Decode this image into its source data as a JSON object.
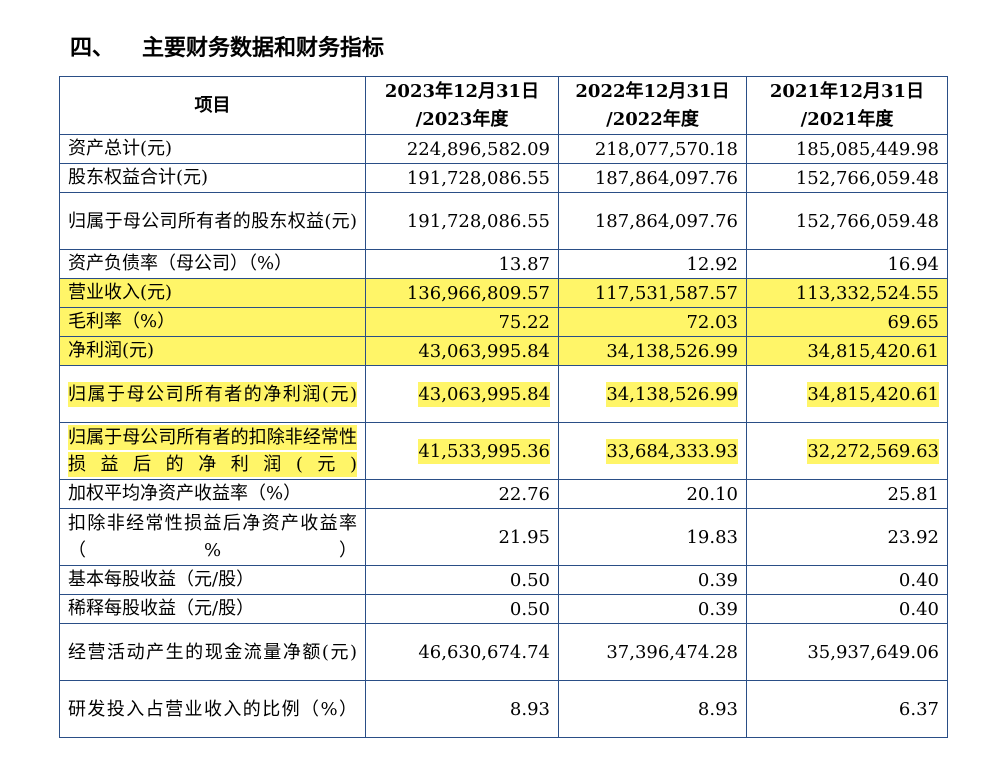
{
  "section": {
    "number": "四、",
    "title": "主要财务数据和财务指标"
  },
  "table": {
    "header": {
      "item": "项目",
      "cols": [
        {
          "line1": "2023年12月31日",
          "line2": "/2023年度"
        },
        {
          "line1": "2022年12月31日",
          "line2": "/2022年度"
        },
        {
          "line1": "2021年12月31日",
          "line2": "/2021年度"
        }
      ]
    },
    "rows": [
      {
        "label": "资产总计(元)",
        "values": [
          "224,896,582.09",
          "218,077,570.18",
          "185,085,449.98"
        ],
        "highlight": "none"
      },
      {
        "label": "股东权益合计(元)",
        "values": [
          "191,728,086.55",
          "187,864,097.76",
          "152,766,059.48"
        ],
        "highlight": "none"
      },
      {
        "label": "归属于母公司所有者的股东权益(元)",
        "values": [
          "191,728,086.55",
          "187,864,097.76",
          "152,766,059.48"
        ],
        "highlight": "none"
      },
      {
        "label": "资产负债率（母公司）（%）",
        "values": [
          "13.87",
          "12.92",
          "16.94"
        ],
        "highlight": "none"
      },
      {
        "label": "营业收入(元)",
        "values": [
          "136,966,809.57",
          "117,531,587.57",
          "113,332,524.55"
        ],
        "highlight": "row"
      },
      {
        "label": "毛利率（%）",
        "values": [
          "75.22",
          "72.03",
          "69.65"
        ],
        "highlight": "row"
      },
      {
        "label": "净利润(元)",
        "values": [
          "43,063,995.84",
          "34,138,526.99",
          "34,815,420.61"
        ],
        "highlight": "row"
      },
      {
        "label": "归属于母公司所有者的净利润(元)",
        "values": [
          "43,063,995.84",
          "34,138,526.99",
          "34,815,420.61"
        ],
        "highlight": "text"
      },
      {
        "label": "归属于母公司所有者的扣除非经常性损益后的净利润(元)",
        "values": [
          "41,533,995.36",
          "33,684,333.93",
          "32,272,569.63"
        ],
        "highlight": "text"
      },
      {
        "label": "加权平均净资产收益率（%）",
        "values": [
          "22.76",
          "20.10",
          "25.81"
        ],
        "highlight": "none"
      },
      {
        "label": "扣除非经常性损益后净资产收益率（%）",
        "values": [
          "21.95",
          "19.83",
          "23.92"
        ],
        "highlight": "none"
      },
      {
        "label": "基本每股收益（元/股）",
        "values": [
          "0.50",
          "0.39",
          "0.40"
        ],
        "highlight": "none"
      },
      {
        "label": "稀释每股收益（元/股）",
        "values": [
          "0.50",
          "0.39",
          "0.40"
        ],
        "highlight": "none"
      },
      {
        "label": "经营活动产生的现金流量净额(元)",
        "values": [
          "46,630,674.74",
          "37,396,474.28",
          "35,937,649.06"
        ],
        "highlight": "none"
      },
      {
        "label": "研发投入占营业收入的比例（%）",
        "values": [
          "8.93",
          "8.93",
          "6.37"
        ],
        "highlight": "none"
      }
    ]
  },
  "colors": {
    "highlight": "#fff568",
    "border": "#2a4e86"
  }
}
